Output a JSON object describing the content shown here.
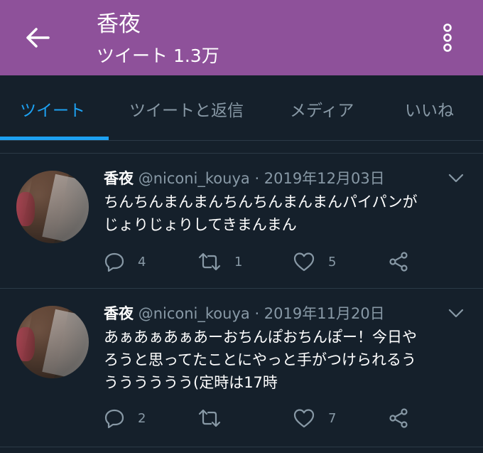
{
  "header": {
    "title": "香夜",
    "subtitle": "ツイート 1.3万"
  },
  "tabs": [
    {
      "label": "ツイート",
      "active": true
    },
    {
      "label": "ツイートと返信",
      "active": false
    },
    {
      "label": "メディア",
      "active": false
    },
    {
      "label": "いいね",
      "active": false
    }
  ],
  "tweets": [
    {
      "name": "香夜",
      "handle": "@niconi_kouya",
      "date": "· 2019年12月03日",
      "lines": [
        "ちんちんまんまんちんちんまんまんパイパンが",
        "じょりじょりしてきまんまん"
      ],
      "replies": "4",
      "retweets": "1",
      "likes": "5"
    },
    {
      "name": "香夜",
      "handle": "@niconi_kouya",
      "date": "· 2019年11月20日",
      "lines": [
        "あぁあぁあぁあーおちんぽおちんぽー！今日や",
        "ろうと思ってたことにやっと手がつけられるう",
        "うううううう(定時は17時"
      ],
      "replies": "2",
      "retweets": "",
      "likes": "7"
    }
  ],
  "colors": {
    "appbar": "#8e519a",
    "background": "#15202b",
    "accent": "#1da1f2",
    "muted": "#8899a6"
  },
  "icons": [
    "back-arrow-icon",
    "more-vertical-icon",
    "chevron-down-icon",
    "reply-icon",
    "retweet-icon",
    "like-icon",
    "share-icon"
  ]
}
